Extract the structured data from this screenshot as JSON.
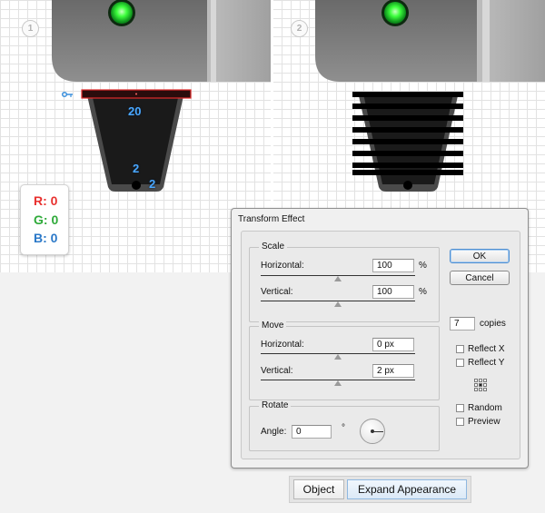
{
  "steps": [
    "1",
    "2"
  ],
  "dimensions": {
    "top_width": "20",
    "bottom_width": "2",
    "corner_radius": "2"
  },
  "color_swatch": {
    "r": "R: 0",
    "g": "G: 0",
    "b": "B: 0",
    "value_color": "#000000"
  },
  "colors": {
    "accent_red": "#e8312f",
    "accent_green": "#2faa3a",
    "accent_blue": "#2a78c8",
    "led": "#3dff3d",
    "dimension": "#4aa8ff"
  },
  "dialog": {
    "title": "Transform Effect",
    "scale": {
      "label": "Scale",
      "horizontal_label": "Horizontal:",
      "horizontal_value": "100",
      "horizontal_unit": "%",
      "vertical_label": "Vertical:",
      "vertical_value": "100",
      "vertical_unit": "%"
    },
    "move": {
      "label": "Move",
      "horizontal_label": "Horizontal:",
      "horizontal_value": "0 px",
      "vertical_label": "Vertical:",
      "vertical_value": "2 px"
    },
    "rotate": {
      "label": "Rotate",
      "angle_label": "Angle:",
      "angle_value": "0",
      "angle_unit": "°"
    },
    "ok_label": "OK",
    "cancel_label": "Cancel",
    "copies_value": "7",
    "copies_label": "copies",
    "reflect_x_label": "Reflect X",
    "reflect_y_label": "Reflect Y",
    "random_label": "Random",
    "preview_label": "Preview"
  },
  "bottom_buttons": {
    "object_label": "Object",
    "expand_label": "Expand Appearance"
  }
}
